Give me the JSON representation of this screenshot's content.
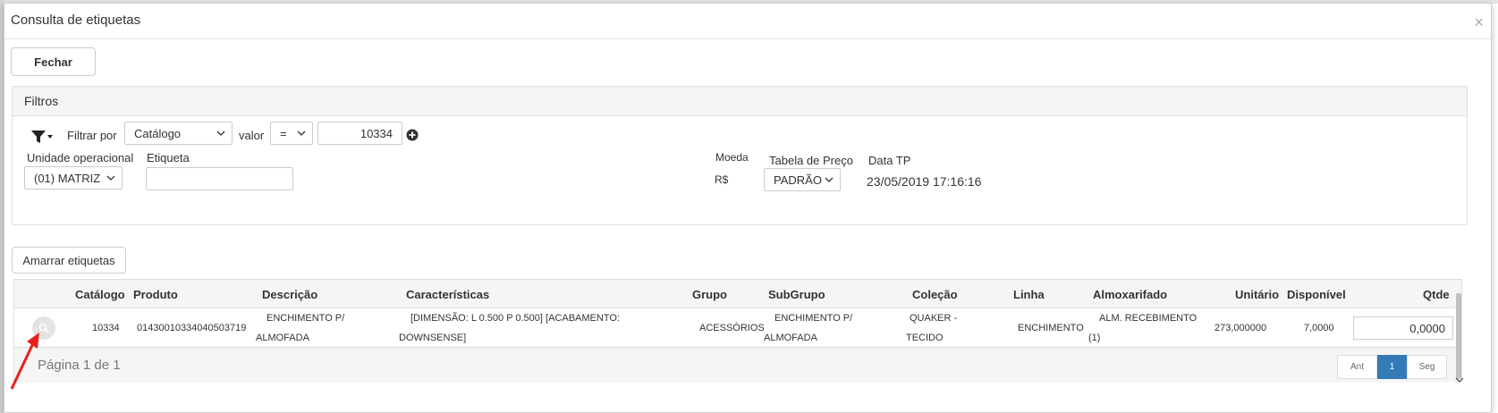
{
  "modal": {
    "title": "Consulta de etiquetas",
    "close": "×"
  },
  "buttons": {
    "fechar": "Fechar",
    "amarrar": "Amarrar etiquetas"
  },
  "filters": {
    "title": "Filtros",
    "filtrar_por_label": "Filtrar por",
    "filtrar_por_value": "Catálogo",
    "valor_label": "valor",
    "operator_value": "=",
    "value": "10334",
    "unidade_label": "Unidade operacional",
    "unidade_value": "(01) MATRIZ",
    "etiqueta_label": "Etiqueta",
    "etiqueta_value": "",
    "moeda_label": "Moeda",
    "moeda_value": "R$",
    "tabela_label": "Tabela de Preço",
    "tabela_value": "PADRÃO",
    "data_label": "Data TP",
    "data_value": "23/05/2019 17:16:16"
  },
  "table": {
    "columns": [
      "Catálogo",
      "Produto",
      "Descrição",
      "Características",
      "Grupo",
      "SubGrupo",
      "Coleção",
      "Linha",
      "Almoxarifado",
      "Unitário",
      "Disponível",
      "Qtde"
    ],
    "rows": [
      {
        "catalogo": "10334",
        "produto": "01430010334040503719",
        "descricao_1": "ENCHIMENTO P/",
        "descricao_2": "ALMOFADA",
        "caracteristicas_1": "[DIMENSÃO: L 0.500 P 0.500] [ACABAMENTO:",
        "caracteristicas_2": "DOWNSENSE]",
        "grupo": "ACESSÓRIOS",
        "subgrupo_1": "ENCHIMENTO P/",
        "subgrupo_2": "ALMOFADA",
        "colecao_1": "QUAKER -",
        "colecao_2": "TECIDO",
        "linha": "ENCHIMENTO",
        "almox_1": "ALM. RECEBIMENTO",
        "almox_2": "(1)",
        "unitario": "273,000000",
        "disponivel": "7,0000",
        "qtde": "0,0000"
      }
    ],
    "page_info": "Página 1 de 1",
    "pager": {
      "prev": "Ant",
      "current": "1",
      "next": "Seg"
    }
  },
  "colors": {
    "accent": "#337ab7",
    "annotation_arrow": "#e8201a"
  },
  "icons": {
    "filter": "filter-icon",
    "add": "plus-circle-icon",
    "search": "search-icon",
    "close": "close-icon",
    "arrow": "red-arrow-annotation"
  }
}
